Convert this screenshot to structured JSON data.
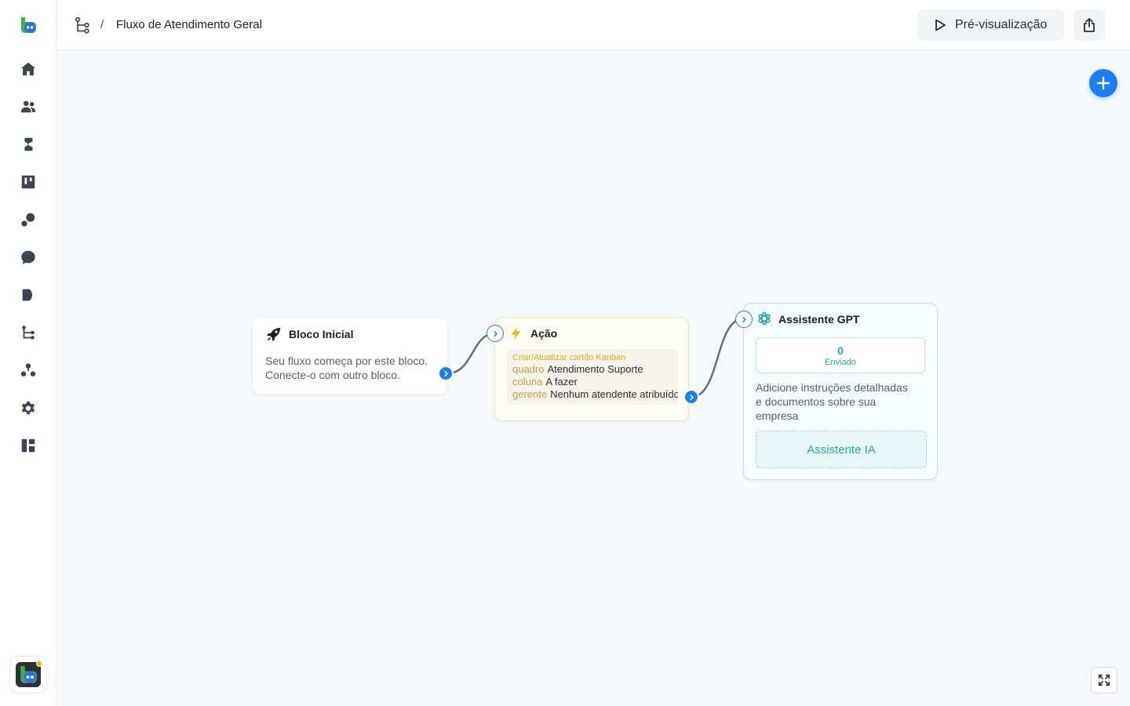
{
  "header": {
    "separator": "/",
    "page_title": "Fluxo de Atendimento Geral",
    "preview_label": "Pré-visualização"
  },
  "sidebar": {
    "items": [
      {
        "name": "home-icon"
      },
      {
        "name": "contacts-icon"
      },
      {
        "name": "campaigns-icon"
      },
      {
        "name": "kanban-icon"
      },
      {
        "name": "integrations-icon"
      },
      {
        "name": "chat-icon"
      },
      {
        "name": "play-icon"
      },
      {
        "name": "flows-icon"
      },
      {
        "name": "team-icon"
      },
      {
        "name": "settings-icon"
      },
      {
        "name": "dashboard-icon"
      }
    ]
  },
  "nodes": {
    "start": {
      "title": "Bloco Inicial",
      "desc_line1": "Seu fluxo começa por este bloco.",
      "desc_line2": "Conecte-o com outro bloco."
    },
    "action": {
      "title": "Ação",
      "type_label": "Criar/Atualizar cartão Kanban",
      "rows": [
        {
          "key": "quadro",
          "value": "Atendimento Suporte"
        },
        {
          "key": "coluna",
          "value": "A fazer"
        },
        {
          "key": "gerente",
          "value": "Nenhum atendente atribuído"
        }
      ]
    },
    "gpt": {
      "title": "Assistente GPT",
      "sent_count": "0",
      "sent_label": "Enviado",
      "desc_line1": "Adicione instruções detalhadas",
      "desc_line2": "e documentos sobre sua",
      "desc_line3": "empresa",
      "button_label": "Assistente IA"
    }
  },
  "colors": {
    "accent": "#1a7ff0",
    "action_label": "#e8a51c",
    "gpt_teal": "#22a8a8",
    "edge": "#6b6f75"
  }
}
